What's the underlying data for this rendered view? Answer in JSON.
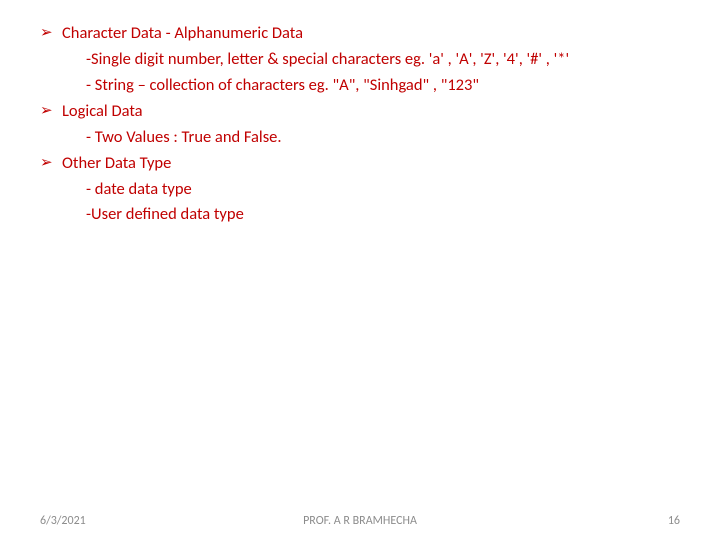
{
  "bullets": [
    {
      "title": "Character Data  - Alphanumeric Data",
      "subs": [
        "-Single digit number, letter & special characters eg. 'a' , 'A', 'Z', '4', '#' , '*'",
        "- String – collection  of characters eg. \"A\", \"Sinhgad\" , \"123\""
      ]
    },
    {
      "title": "Logical Data",
      "subs": [
        "- Two Values : True and False."
      ]
    },
    {
      "title": "Other Data Type",
      "subs": [
        "- date data type",
        "-User defined data type"
      ]
    }
  ],
  "footer": {
    "date": "6/3/2021",
    "author": "PROF. A R BRAMHECHA",
    "page": "16"
  }
}
